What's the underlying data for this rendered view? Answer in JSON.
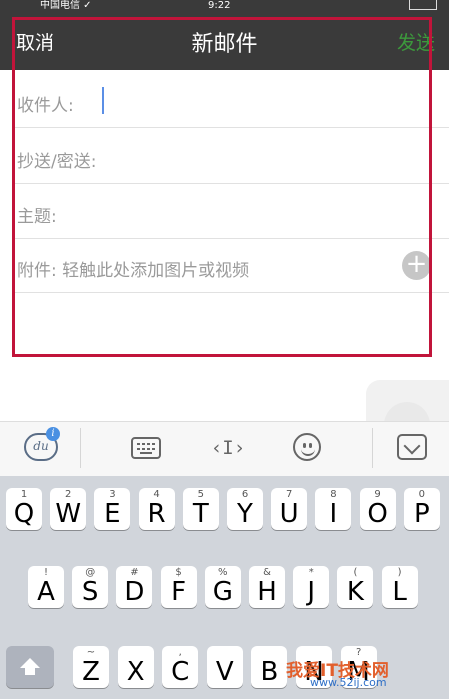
{
  "status_bar": {
    "carrier": "中国电信 ✓",
    "time": "9:22"
  },
  "nav": {
    "cancel": "取消",
    "title": "新邮件",
    "send": "发送"
  },
  "fields": {
    "to_label": "收件人:",
    "cc_label": "抄送/密送:",
    "subject_label": "主题:",
    "attach_label": "附件:  轻触此处添加图片或视频",
    "attach_add": "+"
  },
  "toolbar": {
    "du_logo": "du",
    "du_badge": "i",
    "cursor_icon": "‹I›"
  },
  "keyboard": {
    "row1": [
      {
        "main": "Q",
        "sub": "1"
      },
      {
        "main": "W",
        "sub": "2"
      },
      {
        "main": "E",
        "sub": "3"
      },
      {
        "main": "R",
        "sub": "4"
      },
      {
        "main": "T",
        "sub": "5"
      },
      {
        "main": "Y",
        "sub": "6"
      },
      {
        "main": "U",
        "sub": "7"
      },
      {
        "main": "I",
        "sub": "8"
      },
      {
        "main": "O",
        "sub": "9"
      },
      {
        "main": "P",
        "sub": "0"
      }
    ],
    "row2": [
      {
        "main": "A",
        "sub": "!"
      },
      {
        "main": "S",
        "sub": "@"
      },
      {
        "main": "D",
        "sub": "#"
      },
      {
        "main": "F",
        "sub": "$"
      },
      {
        "main": "G",
        "sub": "%"
      },
      {
        "main": "H",
        "sub": "&"
      },
      {
        "main": "J",
        "sub": "*"
      },
      {
        "main": "K",
        "sub": "("
      },
      {
        "main": "L",
        "sub": ")"
      }
    ],
    "row3": [
      {
        "main": "Z",
        "sub": "~"
      },
      {
        "main": "X",
        "sub": ""
      },
      {
        "main": "C",
        "sub": ","
      },
      {
        "main": "V",
        "sub": ""
      },
      {
        "main": "B",
        "sub": ""
      },
      {
        "main": "N",
        "sub": ""
      },
      {
        "main": "M",
        "sub": "?"
      }
    ]
  },
  "watermark": {
    "text": "我爱IT技术网",
    "url": "www.52ij.com"
  },
  "colors": {
    "nav_bg": "#3a3a3a",
    "send": "#3c9a3c",
    "highlight": "#c1143a",
    "cursor": "#5b8fe6"
  }
}
